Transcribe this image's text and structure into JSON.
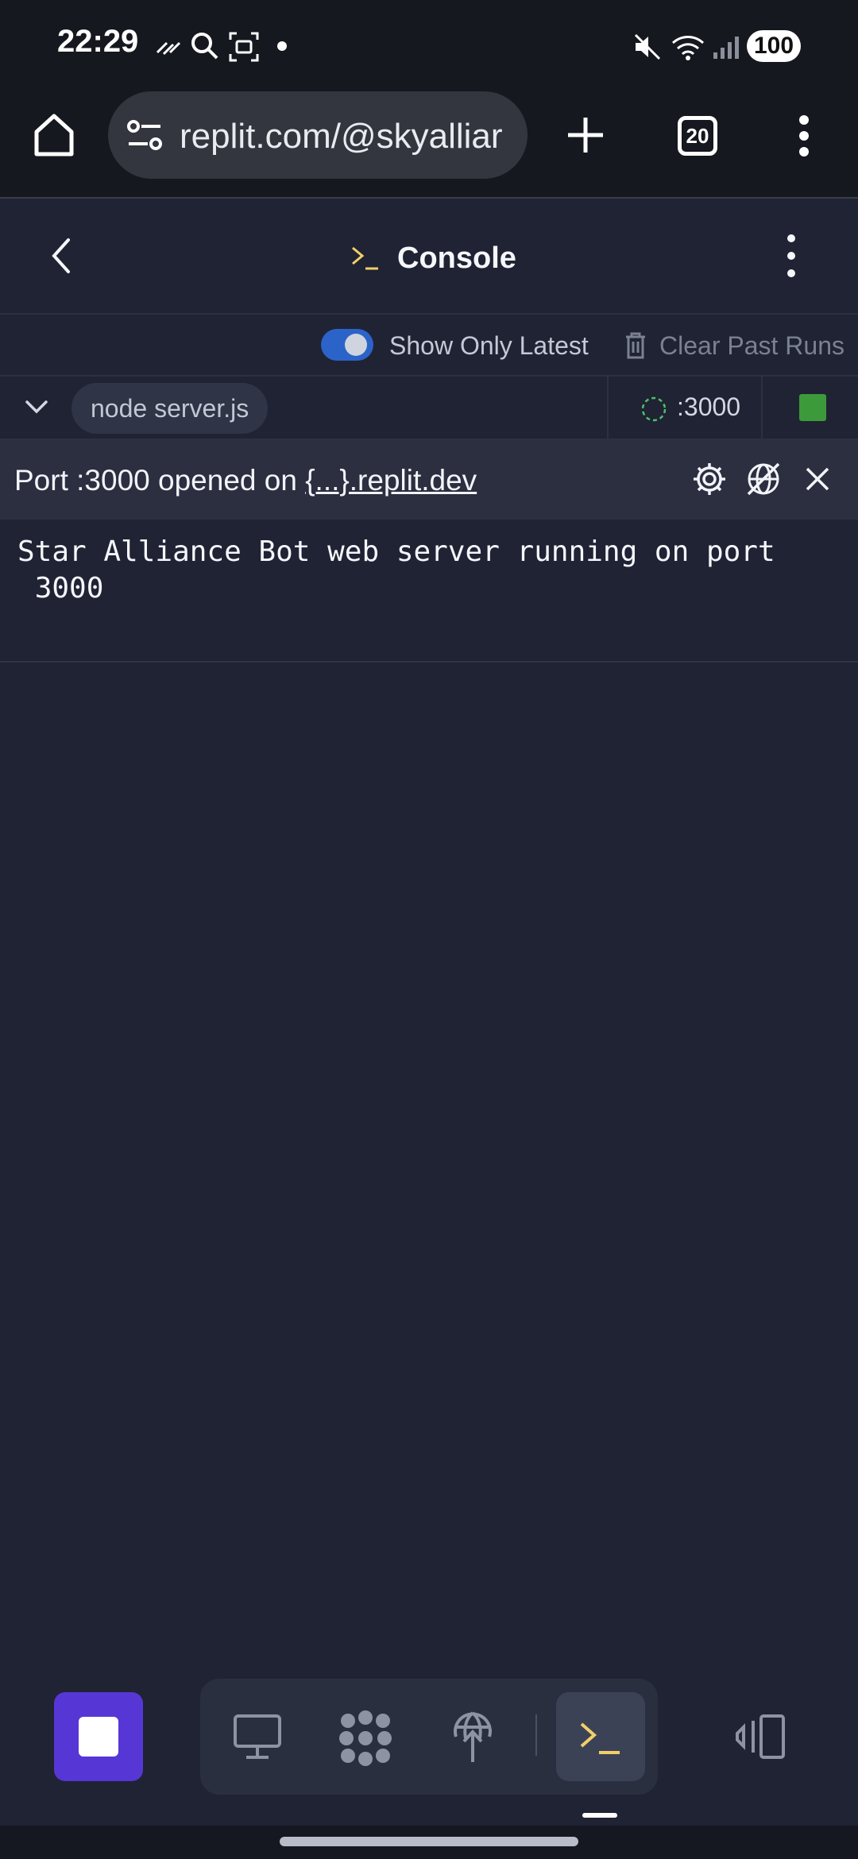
{
  "status_bar": {
    "time": "22:29",
    "battery": "100",
    "icons": [
      "signal-stripes-icon",
      "search-icon",
      "screenshot-icon",
      "dot-icon",
      "mute-icon",
      "wifi-icon",
      "cell-signal-icon"
    ]
  },
  "browser": {
    "url": "replit.com/@skyalliar",
    "tab_count": "20",
    "icons": [
      "home-icon",
      "site-settings-icon",
      "new-tab-icon",
      "tabs-icon",
      "more-icon"
    ]
  },
  "console": {
    "title": "Console",
    "show_only_latest_label": "Show Only Latest",
    "show_only_latest_on": true,
    "clear_past_runs_label": "Clear Past Runs",
    "process_name": "node server.js",
    "port_label": ":3000",
    "banner_prefix": "Port :3000 opened on",
    "banner_link": "{...}.replit.dev",
    "output": "Star Alliance Bot web server running on port\n 3000"
  },
  "colors": {
    "accent_blue": "#2c63c8",
    "run_button": "#5637d6",
    "running_green": "#3c9a3b",
    "console_icon_yellow": "#f2cf6a",
    "panel_bg": "#1f2333"
  }
}
